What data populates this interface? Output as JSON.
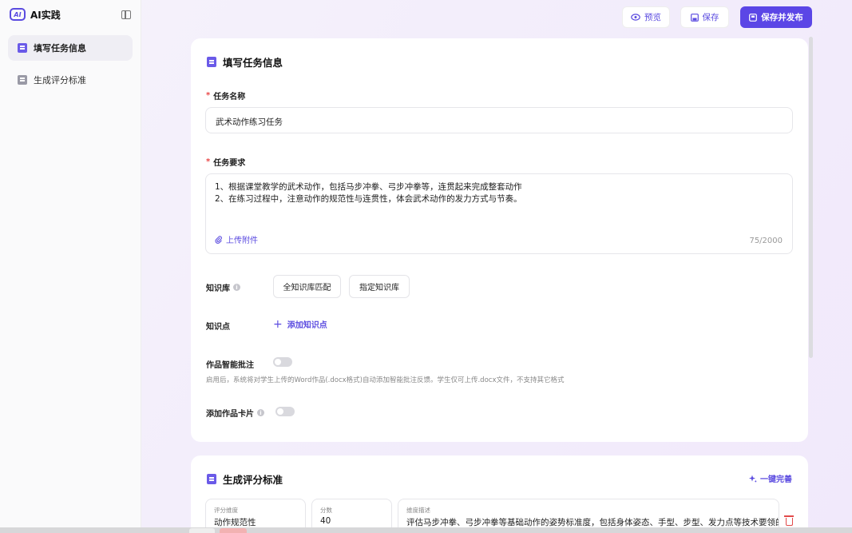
{
  "app": {
    "logo_badge": "AI",
    "title": "AI实践"
  },
  "sidebar": {
    "items": [
      {
        "label": "填写任务信息",
        "active": true
      },
      {
        "label": "生成评分标准",
        "active": false
      }
    ]
  },
  "toolbar": {
    "preview": "预览",
    "save": "保存",
    "save_publish": "保存并发布"
  },
  "task_card": {
    "title": "填写任务信息",
    "name_label": "任务名称",
    "name_value": "武术动作练习任务",
    "req_label": "任务要求",
    "req_lines": [
      "1、根据课堂教学的武术动作，包括马步冲拳、弓步冲拳等，连贯起来完成整套动作",
      "2、在练习过程中，注意动作的规范性与连贯性，体会武术动作的发力方式与节奏。"
    ],
    "upload": "上传附件",
    "counter": "75/2000",
    "kb_label": "知识库",
    "kb_options": [
      "全知识库匹配",
      "指定知识库"
    ],
    "kp_label": "知识点",
    "kp_add": "添加知识点",
    "smart_label": "作品智能批注",
    "smart_enabled": false,
    "smart_hint": "启用后，系统将对学生上传的Word作品(.docx格式)自动添加智能批注反馈。学生仅可上传.docx文件，不支持其它格式",
    "card_label": "添加作品卡片",
    "card_enabled": false
  },
  "rubric_card": {
    "title": "生成评分标准",
    "one_click": "一键完善",
    "row": {
      "dim_label": "评分维度",
      "dim_value": "动作规范性",
      "score_label": "分数",
      "score_value": "40",
      "desc_label": "维度描述",
      "desc_value": "评估马步冲拳、弓步冲拳等基础动作的姿势标准度，包括身体姿态、手型、步型、发力点等技术要领的掌"
    }
  },
  "colors": {
    "accent": "#5b46e6",
    "required": "#e94545",
    "danger": "#e24a4a"
  }
}
